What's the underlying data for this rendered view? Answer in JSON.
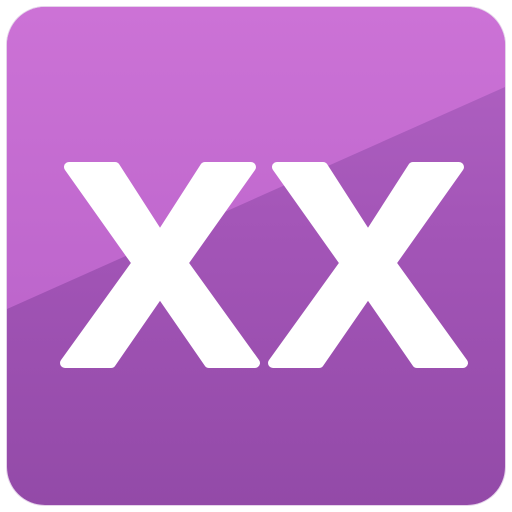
{
  "icon": {
    "glyph": "XX",
    "background_top": "#c96fd3",
    "background_bottom": "#934aa8",
    "glyph_color": "#ffffff"
  }
}
